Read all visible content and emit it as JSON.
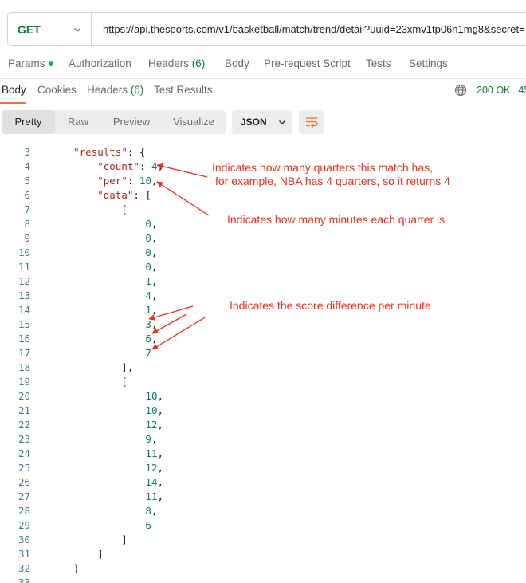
{
  "request": {
    "method": "GET",
    "url": "https://api.thesports.com/v1/basketball/match/trend/detail?uuid=23xmv1tp06n1mg8&secret="
  },
  "request_tabs": [
    {
      "label": "Params"
    },
    {
      "label": "Authorization"
    },
    {
      "label": "Headers",
      "count": "(6)"
    },
    {
      "label": "Body"
    },
    {
      "label": "Pre-request Script"
    },
    {
      "label": "Tests"
    },
    {
      "label": "Settings"
    }
  ],
  "response_tabs": [
    {
      "label": "Body"
    },
    {
      "label": "Cookies"
    },
    {
      "label": "Headers",
      "count": "(6)"
    },
    {
      "label": "Test Results"
    }
  ],
  "response_status": {
    "code": "200 OK",
    "time": "45"
  },
  "format_buttons": [
    "Pretty",
    "Raw",
    "Preview",
    "Visualize"
  ],
  "format_select": "JSON",
  "code_lines": [
    {
      "n": "3",
      "tokens": [
        {
          "t": "    "
        },
        {
          "t": "\"results\"",
          "c": "k"
        },
        {
          "t": ": {"
        }
      ]
    },
    {
      "n": "4",
      "tokens": [
        {
          "t": "        "
        },
        {
          "t": "\"count\"",
          "c": "k"
        },
        {
          "t": ": "
        },
        {
          "t": "4",
          "c": "n"
        },
        {
          "t": ","
        }
      ]
    },
    {
      "n": "5",
      "tokens": [
        {
          "t": "        "
        },
        {
          "t": "\"per\"",
          "c": "k"
        },
        {
          "t": ": "
        },
        {
          "t": "10",
          "c": "n"
        },
        {
          "t": ","
        }
      ]
    },
    {
      "n": "6",
      "tokens": [
        {
          "t": "        "
        },
        {
          "t": "\"data\"",
          "c": "k"
        },
        {
          "t": ": ["
        }
      ]
    },
    {
      "n": "7",
      "tokens": [
        {
          "t": "            ["
        }
      ]
    },
    {
      "n": "8",
      "tokens": [
        {
          "t": "                "
        },
        {
          "t": "0",
          "c": "n"
        },
        {
          "t": ","
        }
      ]
    },
    {
      "n": "9",
      "tokens": [
        {
          "t": "                "
        },
        {
          "t": "0",
          "c": "n"
        },
        {
          "t": ","
        }
      ]
    },
    {
      "n": "10",
      "tokens": [
        {
          "t": "                "
        },
        {
          "t": "0",
          "c": "n"
        },
        {
          "t": ","
        }
      ]
    },
    {
      "n": "11",
      "tokens": [
        {
          "t": "                "
        },
        {
          "t": "0",
          "c": "n"
        },
        {
          "t": ","
        }
      ]
    },
    {
      "n": "12",
      "tokens": [
        {
          "t": "                "
        },
        {
          "t": "1",
          "c": "n"
        },
        {
          "t": ","
        }
      ]
    },
    {
      "n": "13",
      "tokens": [
        {
          "t": "                "
        },
        {
          "t": "4",
          "c": "n"
        },
        {
          "t": ","
        }
      ]
    },
    {
      "n": "14",
      "tokens": [
        {
          "t": "                "
        },
        {
          "t": "1",
          "c": "n"
        },
        {
          "t": ","
        }
      ]
    },
    {
      "n": "15",
      "tokens": [
        {
          "t": "                "
        },
        {
          "t": "3",
          "c": "n"
        },
        {
          "t": ","
        }
      ]
    },
    {
      "n": "16",
      "tokens": [
        {
          "t": "                "
        },
        {
          "t": "6",
          "c": "n"
        },
        {
          "t": ","
        }
      ]
    },
    {
      "n": "17",
      "tokens": [
        {
          "t": "                "
        },
        {
          "t": "7",
          "c": "n"
        }
      ]
    },
    {
      "n": "18",
      "tokens": [
        {
          "t": "            ],"
        }
      ]
    },
    {
      "n": "19",
      "tokens": [
        {
          "t": "            ["
        }
      ]
    },
    {
      "n": "20",
      "tokens": [
        {
          "t": "                "
        },
        {
          "t": "10",
          "c": "n"
        },
        {
          "t": ","
        }
      ]
    },
    {
      "n": "21",
      "tokens": [
        {
          "t": "                "
        },
        {
          "t": "10",
          "c": "n"
        },
        {
          "t": ","
        }
      ]
    },
    {
      "n": "22",
      "tokens": [
        {
          "t": "                "
        },
        {
          "t": "12",
          "c": "n"
        },
        {
          "t": ","
        }
      ]
    },
    {
      "n": "23",
      "tokens": [
        {
          "t": "                "
        },
        {
          "t": "9",
          "c": "n"
        },
        {
          "t": ","
        }
      ]
    },
    {
      "n": "24",
      "tokens": [
        {
          "t": "                "
        },
        {
          "t": "11",
          "c": "n"
        },
        {
          "t": ","
        }
      ]
    },
    {
      "n": "25",
      "tokens": [
        {
          "t": "                "
        },
        {
          "t": "12",
          "c": "n"
        },
        {
          "t": ","
        }
      ]
    },
    {
      "n": "26",
      "tokens": [
        {
          "t": "                "
        },
        {
          "t": "14",
          "c": "n"
        },
        {
          "t": ","
        }
      ]
    },
    {
      "n": "27",
      "tokens": [
        {
          "t": "                "
        },
        {
          "t": "11",
          "c": "n"
        },
        {
          "t": ","
        }
      ]
    },
    {
      "n": "28",
      "tokens": [
        {
          "t": "                "
        },
        {
          "t": "8",
          "c": "n"
        },
        {
          "t": ","
        }
      ]
    },
    {
      "n": "29",
      "tokens": [
        {
          "t": "                "
        },
        {
          "t": "6",
          "c": "n"
        }
      ]
    },
    {
      "n": "30",
      "tokens": [
        {
          "t": "            ]"
        }
      ]
    },
    {
      "n": "31",
      "tokens": [
        {
          "t": "        ]"
        }
      ]
    },
    {
      "n": "32",
      "tokens": [
        {
          "t": "    }"
        }
      ]
    },
    {
      "n": "33",
      "tokens": [
        {
          "t": ""
        }
      ]
    }
  ],
  "annotations": [
    {
      "text": "Indicates how many quarters this match has,"
    },
    {
      "text": "for example, NBA has 4 quarters, so it returns 4"
    },
    {
      "text": "Indicates how many minutes each quarter is"
    },
    {
      "text": "Indicates the score difference per minute"
    }
  ],
  "colors": {
    "accent": "#ff6c37",
    "method_get": "#0c7c3a",
    "annotation": "#e8321e",
    "json_key": "#a8261f",
    "json_number": "#097c6c",
    "line_number": "#3c7a9b"
  },
  "icons": {
    "method_dropdown": "chevron-down-icon",
    "status": "globe-icon",
    "wrap": "wrap-lines-icon"
  }
}
